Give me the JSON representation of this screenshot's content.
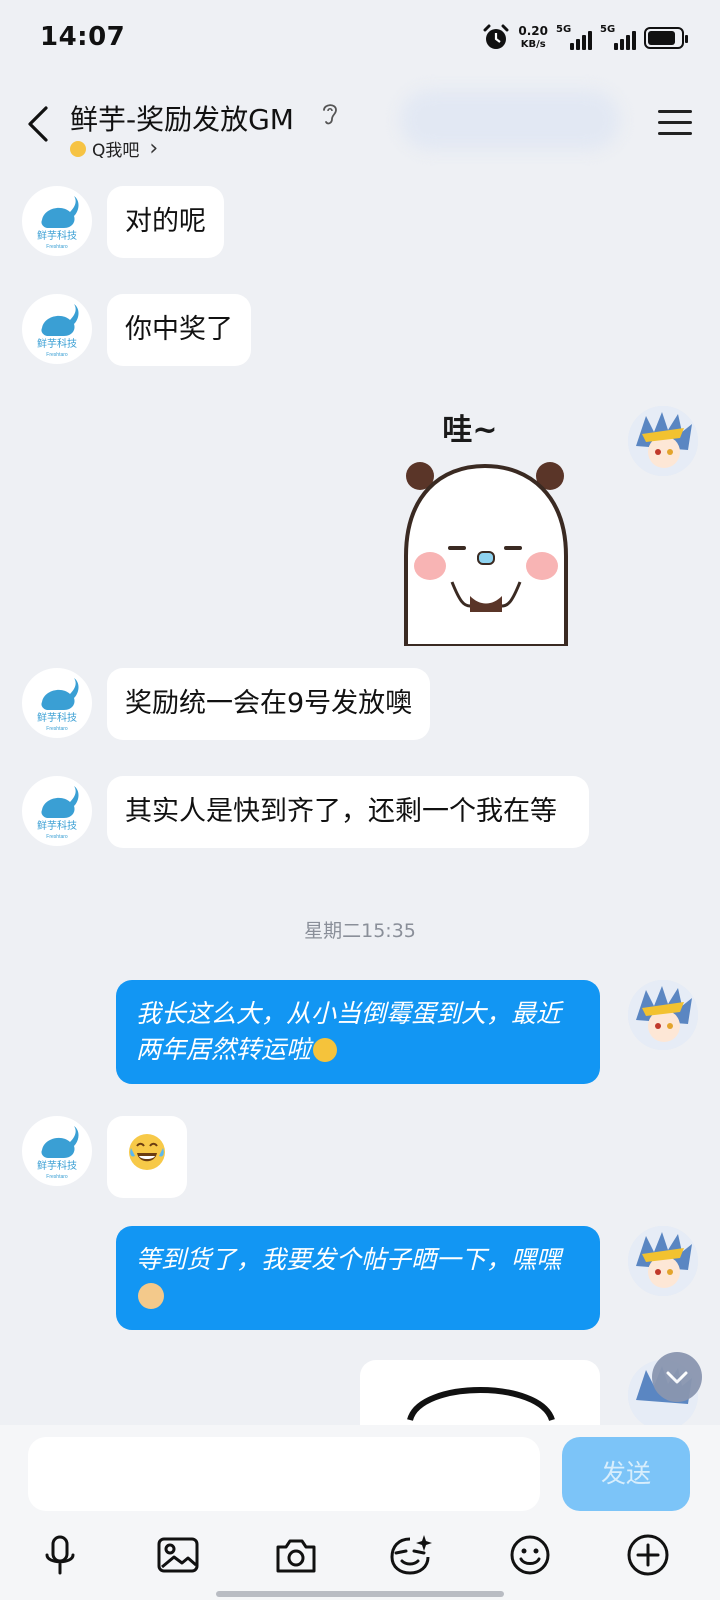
{
  "status_bar": {
    "time": "14:07",
    "net_speed_value": "0.20",
    "net_speed_unit": "KB/s",
    "signal1_label": "5G",
    "signal2_label": "5G"
  },
  "header": {
    "title": "鲜芋-奖励发放GM",
    "subtitle": "Q我吧",
    "subtitle_chevron": "›"
  },
  "bot": {
    "name_on_avatar": "鲜芋科技",
    "name_small": "Freshtaro"
  },
  "messages": [
    {
      "side": "in",
      "text": "对的呢"
    },
    {
      "side": "in",
      "text": "你中奖了"
    },
    {
      "side": "out",
      "type": "sticker",
      "sticker_text": "哇~"
    },
    {
      "side": "in",
      "text": "奖励统一会在9号发放噢"
    },
    {
      "side": "in",
      "text": "其实人是快到齐了，还剩一个我在等"
    },
    {
      "type": "timestamp",
      "text": "星期二15:35"
    },
    {
      "side": "out",
      "text": "我长这么大，从小当倒霉蛋到大，最近两年居然转运啦"
    },
    {
      "side": "in",
      "type": "emoji",
      "icon": "laughing-crying-emoji"
    },
    {
      "side": "out",
      "text": "等到货了，我要发个帖子晒一下，嘿嘿"
    }
  ],
  "input": {
    "placeholder": "",
    "send_label": "发送"
  },
  "toolbar_icons": [
    "microphone-icon",
    "image-icon",
    "camera-icon",
    "sticker-icon",
    "emoji-icon",
    "plus-icon"
  ]
}
